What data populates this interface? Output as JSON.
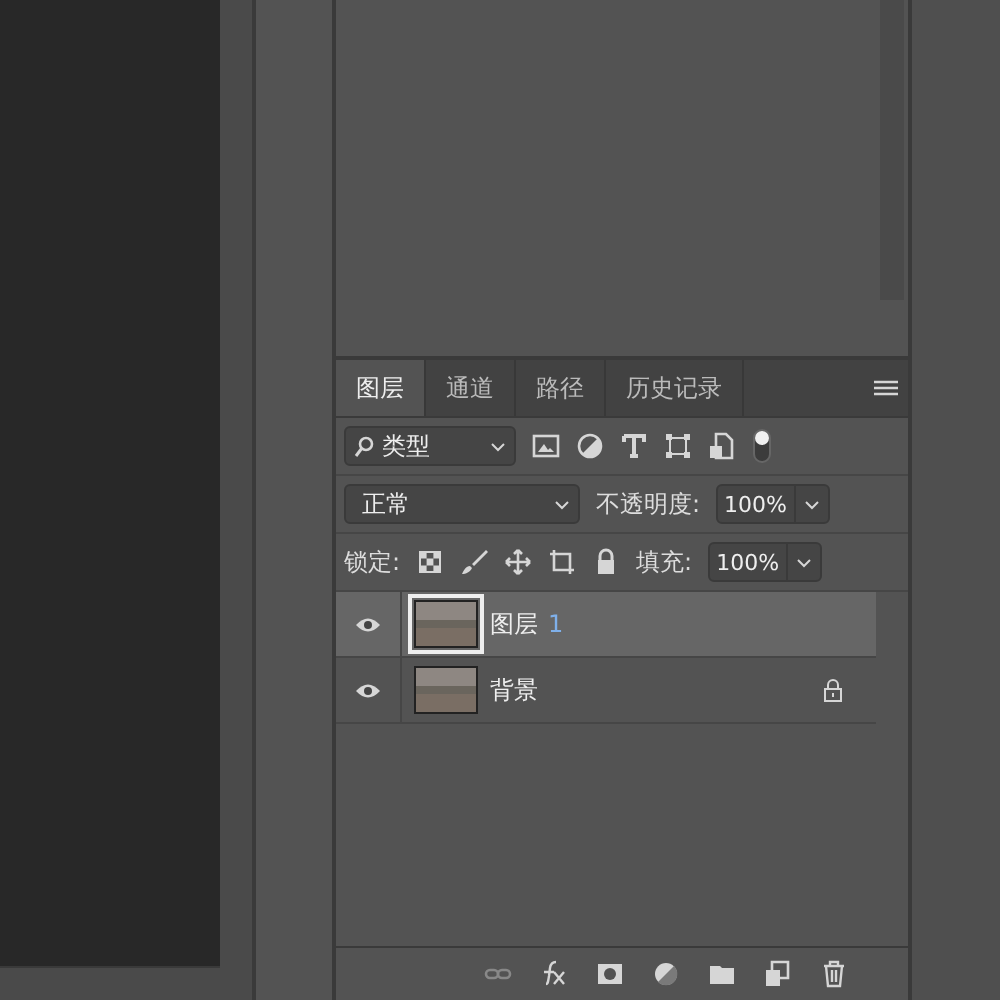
{
  "tabs": [
    {
      "label": "图层",
      "selected": true
    },
    {
      "label": "通道",
      "selected": false
    },
    {
      "label": "路径",
      "selected": false
    },
    {
      "label": "历史记录",
      "selected": false
    }
  ],
  "filter": {
    "value": "类型"
  },
  "blend": {
    "value": "正常",
    "opacity_label": "不透明度:",
    "opacity": "100%"
  },
  "lock": {
    "label": "锁定:",
    "fill_label": "填充:",
    "fill": "100%"
  },
  "layers": [
    {
      "name": "图层",
      "number": "1",
      "selected": true,
      "visible": true,
      "locked": false
    },
    {
      "name": "背景",
      "selected": false,
      "visible": true,
      "locked": true
    }
  ]
}
